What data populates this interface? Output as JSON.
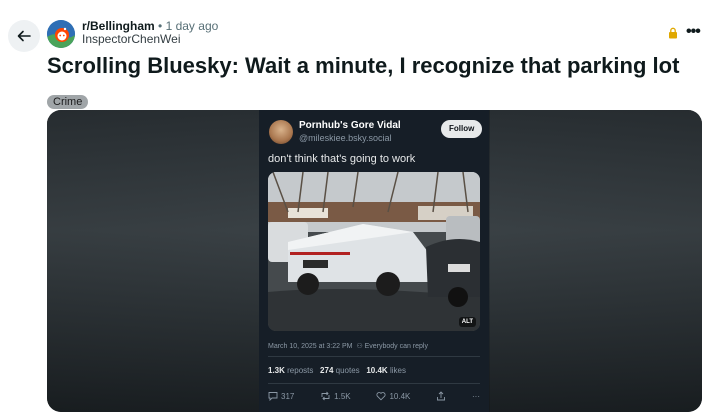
{
  "header": {
    "subreddit": "r/Bellingham",
    "separator": "•",
    "time": "1 day ago",
    "author": "InspectorChenWei"
  },
  "post": {
    "title": "Scrolling Bluesky: Wait a minute, I recognize that parking lot",
    "flair": "Crime"
  },
  "icons": {
    "back": "back-arrow-icon",
    "subreddit_avatar": "subreddit-avatar-icon",
    "lock": "lock-icon",
    "more": "more-options-icon"
  },
  "colors": {
    "lock": "#e0a800",
    "tweet_bg": "#161e27",
    "media_bg": "#0c0f11"
  },
  "tweet": {
    "display_name": "Pornhub's Gore Vidal",
    "handle": "@mileskiee.bsky.social",
    "follow_label": "Follow",
    "text": "don't think that's going to work",
    "alt_badge": "ALT",
    "date": "March 10, 2025 at 3:22 PM",
    "reply_scope": "Everybody can reply",
    "reposts_count": "1.3K",
    "reposts_label": "reposts",
    "quotes_count": "274",
    "quotes_label": "quotes",
    "likes_count": "10.4K",
    "likes_label": "likes",
    "actions": {
      "replies": "317",
      "reposts": "1.5K",
      "likes": "10.4K",
      "more": "···"
    }
  }
}
